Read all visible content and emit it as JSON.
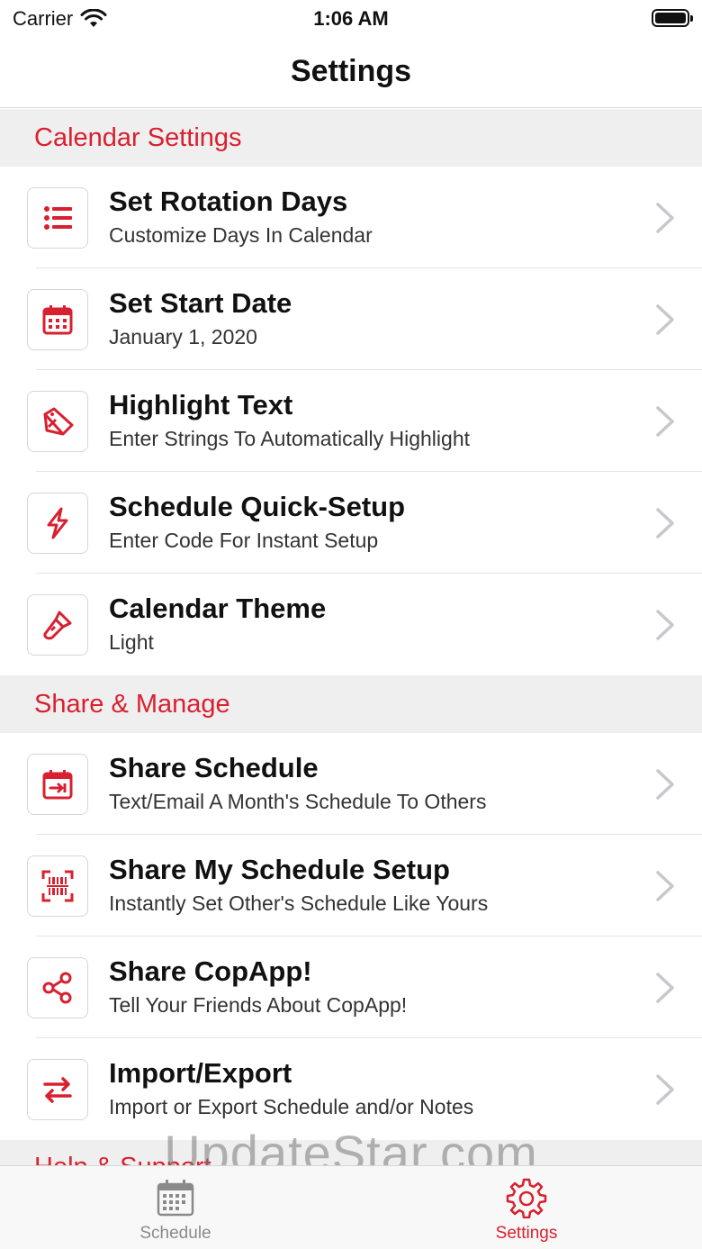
{
  "status_bar": {
    "carrier": "Carrier",
    "time": "1:06 AM"
  },
  "nav": {
    "title": "Settings"
  },
  "sections": [
    {
      "title": "Calendar Settings",
      "items": [
        {
          "title": "Set Rotation Days",
          "subtitle": "Customize Days In Calendar",
          "icon": "list-icon"
        },
        {
          "title": "Set Start Date",
          "subtitle": "January 1, 2020",
          "icon": "calendar-icon"
        },
        {
          "title": "Highlight Text",
          "subtitle": "Enter Strings To Automatically Highlight",
          "icon": "highlighter-icon"
        },
        {
          "title": "Schedule Quick-Setup",
          "subtitle": "Enter Code For Instant Setup",
          "icon": "bolt-icon"
        },
        {
          "title": "Calendar Theme",
          "subtitle": "Light",
          "icon": "brush-icon"
        }
      ]
    },
    {
      "title": "Share & Manage",
      "items": [
        {
          "title": "Share Schedule",
          "subtitle": "Text/Email A Month's Schedule To Others",
          "icon": "calendar-export-icon"
        },
        {
          "title": "Share My Schedule Setup",
          "subtitle": "Instantly Set Other's Schedule Like Yours",
          "icon": "barcode-scan-icon"
        },
        {
          "title": "Share CopApp!",
          "subtitle": "Tell Your Friends About CopApp!",
          "icon": "share-icon"
        },
        {
          "title": "Import/Export",
          "subtitle": "Import or Export Schedule and/or Notes",
          "icon": "swap-arrows-icon"
        }
      ]
    },
    {
      "title": "Help & Support"
    }
  ],
  "tab_bar": {
    "tabs": [
      {
        "label": "Schedule",
        "icon": "calendar-grid-icon",
        "active": false
      },
      {
        "label": "Settings",
        "icon": "gear-icon",
        "active": true
      }
    ]
  },
  "watermark": "UpdateStar.com",
  "colors": {
    "accent": "#d9202f",
    "section_bg": "#efeff0",
    "inactive": "#8a8a8a"
  }
}
